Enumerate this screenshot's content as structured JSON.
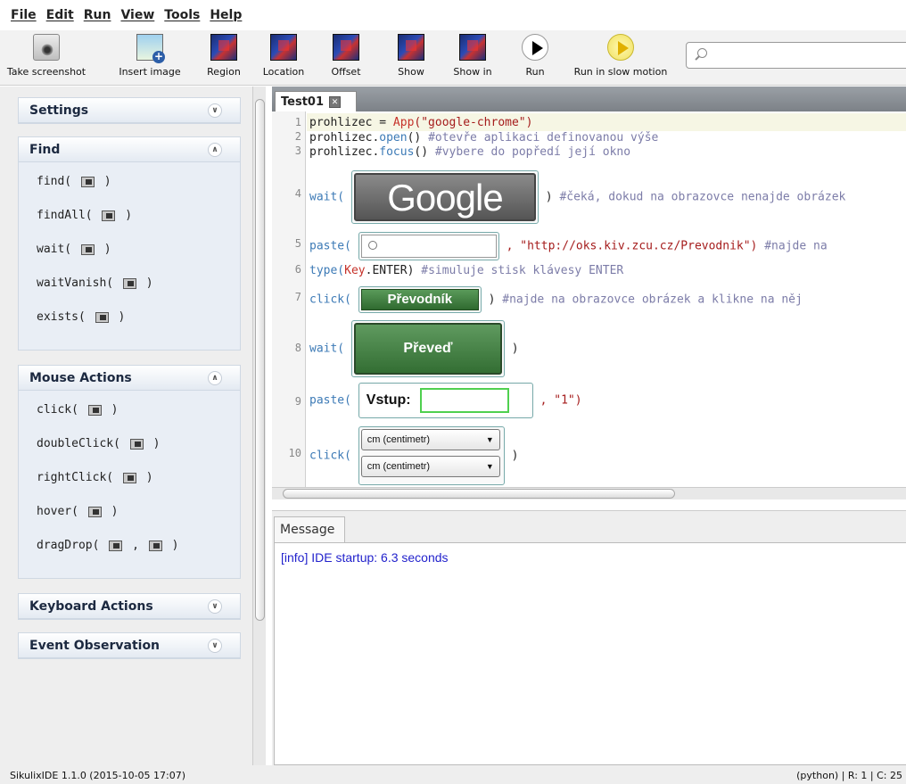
{
  "menu": [
    "File",
    "Edit",
    "Run",
    "View",
    "Tools",
    "Help"
  ],
  "toolbar": {
    "take_screenshot": "Take screenshot",
    "insert_image": "Insert image",
    "region": "Region",
    "location": "Location",
    "offset": "Offset",
    "show": "Show",
    "show_in": "Show in",
    "run": "Run",
    "run_slow": "Run in slow motion"
  },
  "sidebar": {
    "settings": "Settings",
    "find": {
      "title": "Find",
      "items": [
        "find(",
        "findAll(",
        "wait(",
        "waitVanish(",
        "exists("
      ]
    },
    "mouse": {
      "title": "Mouse Actions",
      "items": [
        "click(",
        "doubleClick(",
        "rightClick(",
        "hover(",
        "dragDrop("
      ]
    },
    "keyboard": "Keyboard Actions",
    "events": "Event Observation"
  },
  "editor": {
    "tab_title": "Test01",
    "lines": {
      "l1_a": "prohlizec = ",
      "l1_b": "App",
      "l1_c": "(\"google-chrome\")",
      "l2_a": "prohlizec.",
      "l2_b": "open",
      "l2_c": "()    ",
      "l2_cm": "#otevře aplikaci definovanou výše",
      "l3_a": "prohlizec.",
      "l3_b": "focus",
      "l3_c": "()    ",
      "l3_cm": "#vybere do popředí její okno",
      "l4_a": "wait(",
      "l4_img": "Google",
      "l4_c": ")   ",
      "l4_cm": "#čeká, dokud na obrazovce nenajde obrázek",
      "l5_a": "paste(",
      "l5_c": ", \"http://oks.kiv.zcu.cz/Prevodnik\")   ",
      "l5_cm": "#najde na",
      "l6_a": "type(",
      "l6_b": "Key",
      "l6_c": ".ENTER)   ",
      "l6_cm": "#simuluje stisk klávesy ENTER",
      "l7_a": "click(",
      "l7_img": "Převodník",
      "l7_c": ")   ",
      "l7_cm": "#najde na obrazovce obrázek a klikne na něj",
      "l8_a": "wait(",
      "l8_img": "Převeď",
      "l8_c": ")",
      "l9_a": "paste(",
      "l9_img": "Vstup:",
      "l9_c": ", \"1\")",
      "l10_a": "click(",
      "l10_opt1": "cm (centimetr)",
      "l10_opt2": "cm (centimetr)",
      "l10_c": ")"
    },
    "line_numbers": [
      "1",
      "2",
      "3",
      "4",
      "5",
      "6",
      "7",
      "8",
      "9",
      "10"
    ]
  },
  "message": {
    "tab": "Message",
    "text": "[info] IDE startup: 6.3 seconds"
  },
  "status": {
    "left": "SikulixIDE 1.1.0 (2015-10-05 17:07)",
    "right": "(python) | R: 1 | C: 25"
  }
}
